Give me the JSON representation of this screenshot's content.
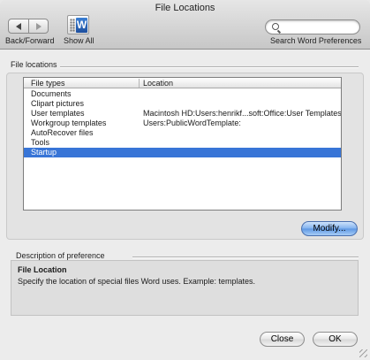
{
  "window": {
    "title": "File Locations"
  },
  "toolbar": {
    "back_forward_label": "Back/Forward",
    "show_all_label": "Show All",
    "show_all_icon_letter": "W",
    "search_placeholder": "",
    "search_label": "Search Word Preferences"
  },
  "file_locations": {
    "group_label": "File locations",
    "columns": [
      "File types",
      "Location"
    ],
    "rows": [
      {
        "type": "Documents",
        "location": ""
      },
      {
        "type": "Clipart pictures",
        "location": ""
      },
      {
        "type": "User templates",
        "location": "Macintosh HD:Users:henrikf...soft:Office:User Templates:"
      },
      {
        "type": "Workgroup templates",
        "location": "Users:PublicWordTemplate:"
      },
      {
        "type": "AutoRecover files",
        "location": ""
      },
      {
        "type": "Tools",
        "location": ""
      },
      {
        "type": "Startup",
        "location": ""
      }
    ],
    "selected_index": 6,
    "modify_label": "Modify..."
  },
  "description": {
    "group_label": "Description of preference",
    "title": "File Location",
    "text": "Specify the location of special files Word uses. Example: templates."
  },
  "buttons": {
    "close": "Close",
    "ok": "OK"
  },
  "colors": {
    "selection": "#3875d7",
    "default_button": "#7fb0ee"
  }
}
